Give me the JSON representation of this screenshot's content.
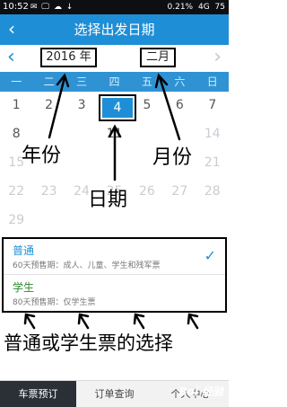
{
  "status": {
    "time": "10:52",
    "icons": "✉ 🖵 ☁ ↓",
    "battery_pct": "0.21%",
    "network": "4G",
    "battery": "75"
  },
  "header": {
    "title": "选择出发日期"
  },
  "nav": {
    "year": "2016 年",
    "month": "二月"
  },
  "weekdays": [
    "一",
    "二",
    "三",
    "四",
    "五",
    "六",
    "日"
  ],
  "calendar": {
    "rows": [
      [
        {
          "d": "1",
          "c": "n"
        },
        {
          "d": "2",
          "c": "n"
        },
        {
          "d": "3",
          "c": "n"
        },
        {
          "d": "4",
          "c": "sel"
        },
        {
          "d": "5",
          "c": "n"
        },
        {
          "d": "6",
          "c": "n"
        },
        {
          "d": "7",
          "c": "n"
        }
      ],
      [
        {
          "d": "8",
          "c": "n"
        },
        {
          "d": "",
          "c": "n"
        },
        {
          "d": "",
          "c": "n"
        },
        {
          "d": "11",
          "c": "n"
        },
        {
          "d": "",
          "c": "n"
        },
        {
          "d": "",
          "c": "n"
        },
        {
          "d": "14",
          "c": "dim"
        }
      ],
      [
        {
          "d": "15",
          "c": "dim"
        },
        {
          "d": "",
          "c": "dim"
        },
        {
          "d": "",
          "c": "dim"
        },
        {
          "d": "",
          "c": "dim"
        },
        {
          "d": "",
          "c": "dim"
        },
        {
          "d": "",
          "c": "dim"
        },
        {
          "d": "21",
          "c": "dim"
        }
      ],
      [
        {
          "d": "22",
          "c": "dim"
        },
        {
          "d": "23",
          "c": "dim"
        },
        {
          "d": "24",
          "c": "dim"
        },
        {
          "d": "25",
          "c": "dim"
        },
        {
          "d": "26",
          "c": "dim"
        },
        {
          "d": "27",
          "c": "dim"
        },
        {
          "d": "28",
          "c": "dim"
        }
      ],
      [
        {
          "d": "29",
          "c": "dim"
        },
        {
          "d": "",
          "c": "n"
        },
        {
          "d": "",
          "c": "n"
        },
        {
          "d": "",
          "c": "n"
        },
        {
          "d": "",
          "c": "n"
        },
        {
          "d": "",
          "c": "n"
        },
        {
          "d": "",
          "c": "n"
        }
      ]
    ]
  },
  "annotations": {
    "year": "年份",
    "month": "月份",
    "day": "日期",
    "bottom": "普通或学生票的选择"
  },
  "tickets": [
    {
      "name": "普通",
      "desc": "60天预售期：成人、儿童、学生和残军票",
      "checked": true
    },
    {
      "name": "学生",
      "desc": "80天预售期：仅学生票",
      "checked": false
    }
  ],
  "tabs": [
    "车票预订",
    "订单查询",
    "个人中心"
  ],
  "watermark": "Bai 经验",
  "colors": {
    "accent": "#1e8fd6",
    "header": "#1e8fd6",
    "weekbar": "#2f93d3",
    "ticket_green": "#2d8c2d"
  }
}
